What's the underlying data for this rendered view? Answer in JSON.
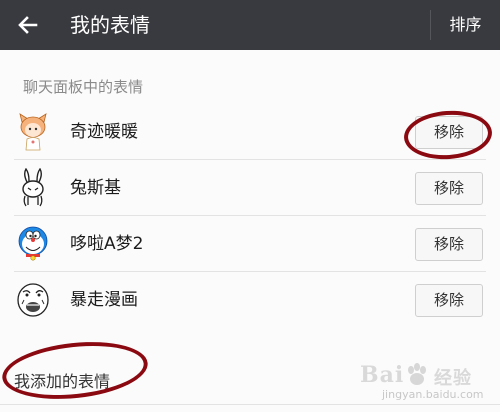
{
  "header": {
    "title": "我的表情",
    "sort_label": "排序",
    "back_icon": "arrow-left-icon"
  },
  "chat_panel_section": {
    "title": "聊天面板中的表情",
    "items": [
      {
        "name": "奇迹暖暖",
        "remove_label": "移除",
        "avatar_icon": "fox-girl-sticker-icon"
      },
      {
        "name": "兔斯基",
        "remove_label": "移除",
        "avatar_icon": "rabbit-sticker-icon"
      },
      {
        "name": "哆啦A梦2",
        "remove_label": "移除",
        "avatar_icon": "doraemon-sticker-icon"
      },
      {
        "name": "暴走漫画",
        "remove_label": "移除",
        "avatar_icon": "rage-face-sticker-icon"
      }
    ]
  },
  "added_section": {
    "title": "我添加的表情"
  },
  "watermark": {
    "logo_text": "Bai",
    "logo_text2": "经验",
    "sub_text": "jingyan.baidu.com"
  },
  "colors": {
    "topbar": "#393a3f",
    "annotation": "#8b0a12"
  }
}
